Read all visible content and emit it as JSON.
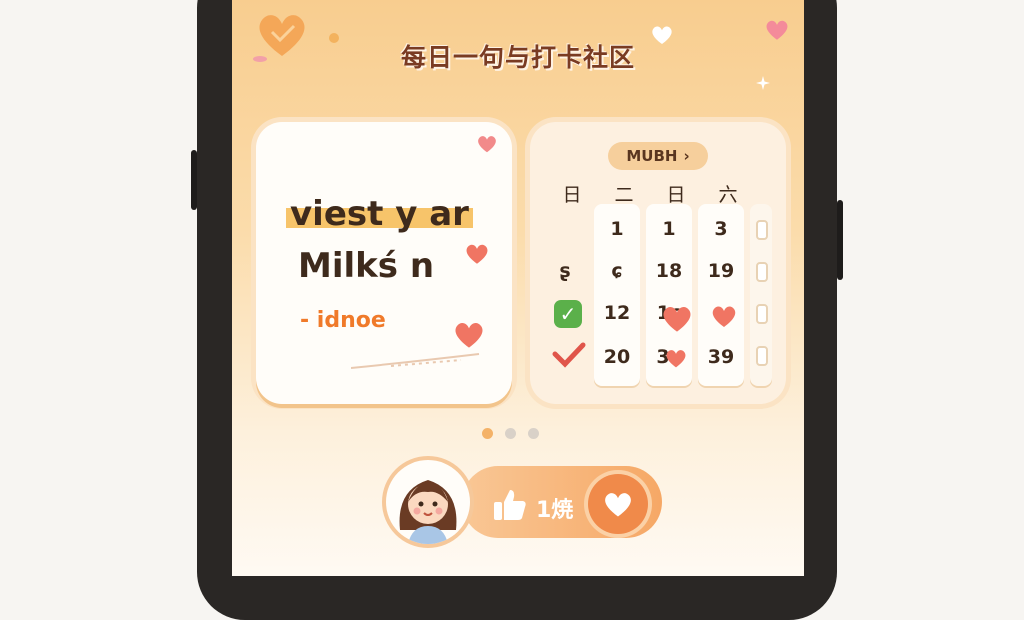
{
  "header": {
    "title": "每日一句与打卡社区"
  },
  "quote": {
    "line1": "viest y ar",
    "line2": "Milkś n",
    "author": "- idnoe"
  },
  "calendar": {
    "month_label": "MUBH",
    "month_chevron": "›",
    "weekdays": [
      "日",
      "二",
      "日",
      "六"
    ],
    "rows": [
      [
        "1",
        "1",
        "3"
      ],
      [
        "ʂ",
        "ɕ",
        "18",
        "19"
      ],
      [
        "",
        "12",
        "1ɕ",
        ""
      ],
      [
        "",
        "20",
        "3",
        "39"
      ]
    ],
    "checked_days": {
      "green": "row3-col1",
      "red": "row4-col1"
    }
  },
  "pagination": {
    "count": 3,
    "active": 0
  },
  "like_bar": {
    "count_label": "1焼"
  },
  "colors": {
    "accent": "#f08a4a",
    "title": "#7a3b22",
    "check_green": "#5bb04a",
    "check_red": "#e0554a",
    "heart": "#f07563"
  },
  "icons": [
    "heart-icon",
    "thumbs-up-icon",
    "check-icon",
    "chevron-right-icon",
    "sparkle-icon"
  ]
}
